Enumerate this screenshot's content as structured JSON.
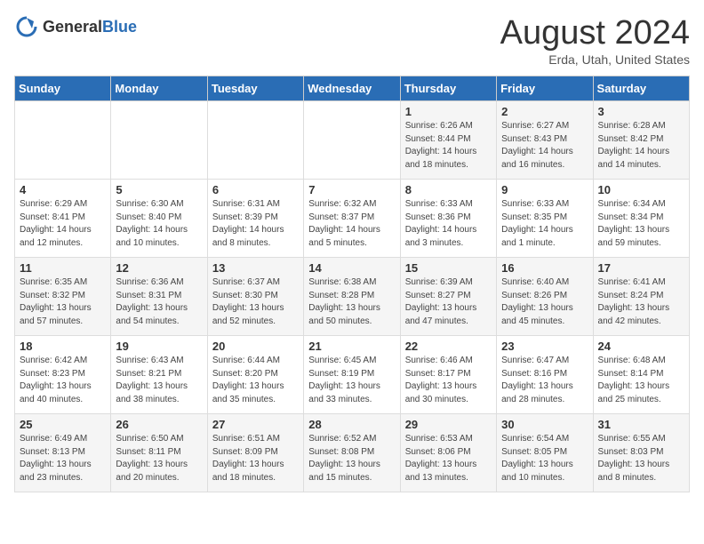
{
  "header": {
    "logo_general": "General",
    "logo_blue": "Blue",
    "month_year": "August 2024",
    "location": "Erda, Utah, United States"
  },
  "days_of_week": [
    "Sunday",
    "Monday",
    "Tuesday",
    "Wednesday",
    "Thursday",
    "Friday",
    "Saturday"
  ],
  "weeks": [
    [
      {
        "day": "",
        "detail": ""
      },
      {
        "day": "",
        "detail": ""
      },
      {
        "day": "",
        "detail": ""
      },
      {
        "day": "",
        "detail": ""
      },
      {
        "day": "1",
        "detail": "Sunrise: 6:26 AM\nSunset: 8:44 PM\nDaylight: 14 hours\nand 18 minutes."
      },
      {
        "day": "2",
        "detail": "Sunrise: 6:27 AM\nSunset: 8:43 PM\nDaylight: 14 hours\nand 16 minutes."
      },
      {
        "day": "3",
        "detail": "Sunrise: 6:28 AM\nSunset: 8:42 PM\nDaylight: 14 hours\nand 14 minutes."
      }
    ],
    [
      {
        "day": "4",
        "detail": "Sunrise: 6:29 AM\nSunset: 8:41 PM\nDaylight: 14 hours\nand 12 minutes."
      },
      {
        "day": "5",
        "detail": "Sunrise: 6:30 AM\nSunset: 8:40 PM\nDaylight: 14 hours\nand 10 minutes."
      },
      {
        "day": "6",
        "detail": "Sunrise: 6:31 AM\nSunset: 8:39 PM\nDaylight: 14 hours\nand 8 minutes."
      },
      {
        "day": "7",
        "detail": "Sunrise: 6:32 AM\nSunset: 8:37 PM\nDaylight: 14 hours\nand 5 minutes."
      },
      {
        "day": "8",
        "detail": "Sunrise: 6:33 AM\nSunset: 8:36 PM\nDaylight: 14 hours\nand 3 minutes."
      },
      {
        "day": "9",
        "detail": "Sunrise: 6:33 AM\nSunset: 8:35 PM\nDaylight: 14 hours\nand 1 minute."
      },
      {
        "day": "10",
        "detail": "Sunrise: 6:34 AM\nSunset: 8:34 PM\nDaylight: 13 hours\nand 59 minutes."
      }
    ],
    [
      {
        "day": "11",
        "detail": "Sunrise: 6:35 AM\nSunset: 8:32 PM\nDaylight: 13 hours\nand 57 minutes."
      },
      {
        "day": "12",
        "detail": "Sunrise: 6:36 AM\nSunset: 8:31 PM\nDaylight: 13 hours\nand 54 minutes."
      },
      {
        "day": "13",
        "detail": "Sunrise: 6:37 AM\nSunset: 8:30 PM\nDaylight: 13 hours\nand 52 minutes."
      },
      {
        "day": "14",
        "detail": "Sunrise: 6:38 AM\nSunset: 8:28 PM\nDaylight: 13 hours\nand 50 minutes."
      },
      {
        "day": "15",
        "detail": "Sunrise: 6:39 AM\nSunset: 8:27 PM\nDaylight: 13 hours\nand 47 minutes."
      },
      {
        "day": "16",
        "detail": "Sunrise: 6:40 AM\nSunset: 8:26 PM\nDaylight: 13 hours\nand 45 minutes."
      },
      {
        "day": "17",
        "detail": "Sunrise: 6:41 AM\nSunset: 8:24 PM\nDaylight: 13 hours\nand 42 minutes."
      }
    ],
    [
      {
        "day": "18",
        "detail": "Sunrise: 6:42 AM\nSunset: 8:23 PM\nDaylight: 13 hours\nand 40 minutes."
      },
      {
        "day": "19",
        "detail": "Sunrise: 6:43 AM\nSunset: 8:21 PM\nDaylight: 13 hours\nand 38 minutes."
      },
      {
        "day": "20",
        "detail": "Sunrise: 6:44 AM\nSunset: 8:20 PM\nDaylight: 13 hours\nand 35 minutes."
      },
      {
        "day": "21",
        "detail": "Sunrise: 6:45 AM\nSunset: 8:19 PM\nDaylight: 13 hours\nand 33 minutes."
      },
      {
        "day": "22",
        "detail": "Sunrise: 6:46 AM\nSunset: 8:17 PM\nDaylight: 13 hours\nand 30 minutes."
      },
      {
        "day": "23",
        "detail": "Sunrise: 6:47 AM\nSunset: 8:16 PM\nDaylight: 13 hours\nand 28 minutes."
      },
      {
        "day": "24",
        "detail": "Sunrise: 6:48 AM\nSunset: 8:14 PM\nDaylight: 13 hours\nand 25 minutes."
      }
    ],
    [
      {
        "day": "25",
        "detail": "Sunrise: 6:49 AM\nSunset: 8:13 PM\nDaylight: 13 hours\nand 23 minutes."
      },
      {
        "day": "26",
        "detail": "Sunrise: 6:50 AM\nSunset: 8:11 PM\nDaylight: 13 hours\nand 20 minutes."
      },
      {
        "day": "27",
        "detail": "Sunrise: 6:51 AM\nSunset: 8:09 PM\nDaylight: 13 hours\nand 18 minutes."
      },
      {
        "day": "28",
        "detail": "Sunrise: 6:52 AM\nSunset: 8:08 PM\nDaylight: 13 hours\nand 15 minutes."
      },
      {
        "day": "29",
        "detail": "Sunrise: 6:53 AM\nSunset: 8:06 PM\nDaylight: 13 hours\nand 13 minutes."
      },
      {
        "day": "30",
        "detail": "Sunrise: 6:54 AM\nSunset: 8:05 PM\nDaylight: 13 hours\nand 10 minutes."
      },
      {
        "day": "31",
        "detail": "Sunrise: 6:55 AM\nSunset: 8:03 PM\nDaylight: 13 hours\nand 8 minutes."
      }
    ]
  ]
}
